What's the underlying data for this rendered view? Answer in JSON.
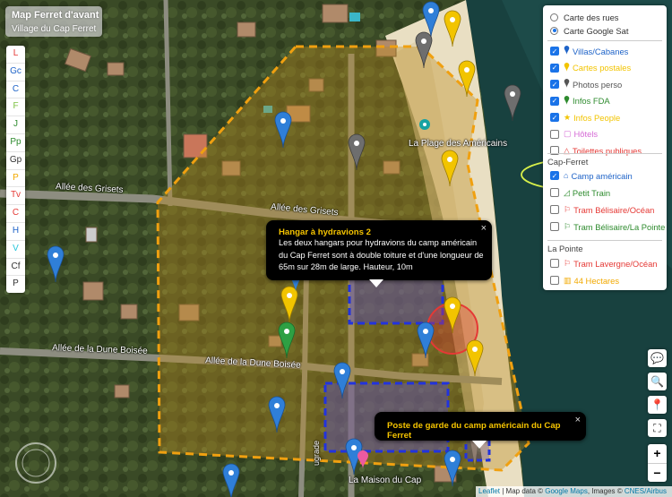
{
  "title": {
    "line1": "Map Ferret d'avant",
    "line2": "Village du Cap Ferret"
  },
  "letters": [
    {
      "t": "L",
      "c": "#e53935"
    },
    {
      "t": "Gc",
      "c": "#1e63c8"
    },
    {
      "t": "C",
      "c": "#1e63c8"
    },
    {
      "t": "F",
      "c": "#7cc242"
    },
    {
      "t": "J",
      "c": "#2e8b2e"
    },
    {
      "t": "Pp",
      "c": "#2e8b2e"
    },
    {
      "t": "Gp",
      "c": "#333333"
    },
    {
      "t": "P",
      "c": "#f2a900"
    },
    {
      "t": "Tv",
      "c": "#e53935"
    },
    {
      "t": "C",
      "c": "#e53935"
    },
    {
      "t": "H",
      "c": "#1e63c8"
    },
    {
      "t": "V",
      "c": "#26c6da"
    },
    {
      "t": "Cf",
      "c": "#333333"
    },
    {
      "t": "P",
      "c": "#333333"
    }
  ],
  "layers": {
    "base": [
      {
        "label": "Carte des rues",
        "checked": false
      },
      {
        "label": "Carte Google Sat",
        "checked": true
      }
    ],
    "overlays": [
      {
        "label": "Villas/Cabanes",
        "checked": true,
        "icon": "pin",
        "color": "#1e63c8"
      },
      {
        "label": "Cartes postales",
        "checked": true,
        "icon": "pin",
        "color": "#f2c400"
      },
      {
        "label": "Photos perso",
        "checked": true,
        "icon": "pin",
        "color": "#555555"
      },
      {
        "label": "Infos FDA",
        "checked": true,
        "icon": "pin",
        "color": "#2e8b2e"
      },
      {
        "label": "Infos People",
        "checked": true,
        "icon": "star",
        "color": "#f2c400"
      },
      {
        "label": "Hôtels",
        "checked": false,
        "icon": "square",
        "color": "#d66bd6"
      },
      {
        "label": "Toilettes publiques",
        "checked": false,
        "icon": "triangle",
        "color": "#e53935"
      }
    ],
    "section1": "Cap-Ferret",
    "cap": [
      {
        "label": "Camp américain",
        "checked": true,
        "icon": "bell",
        "color": "#1e63c8"
      },
      {
        "label": "Petit Train",
        "checked": false,
        "icon": "tri-small",
        "color": "#2e8b2e"
      },
      {
        "label": "Tram Bélisaire/Océan",
        "checked": false,
        "icon": "flag",
        "color": "#e53935"
      },
      {
        "label": "Tram Bélisaire/La Pointe",
        "checked": false,
        "icon": "flag",
        "color": "#2e8b2e"
      }
    ],
    "section2": "La Pointe",
    "pointe": [
      {
        "label": "Tram Lavergne/Océan",
        "checked": false,
        "icon": "flag",
        "color": "#e53935"
      },
      {
        "label": "44 Hectares",
        "checked": false,
        "icon": "bars",
        "color": "#f2a900"
      }
    ]
  },
  "popup1": {
    "title": "Hangar à hydravions 2",
    "lines": [
      "Les deux hangars pour hydravions du camp américain",
      "du Cap Ferret sont à double toiture et d'une longueur de",
      "65m sur 28m de large. Hauteur, 10m"
    ],
    "close": "×"
  },
  "popup2": {
    "title": "Poste de garde du camp américain du Cap Ferret",
    "close": "×"
  },
  "map_labels": {
    "plage": "La Plage des Américains",
    "grisets1": "Allée des Grisets",
    "grisets2": "Allée des Grisets",
    "dune1": "Allée de la Dune Boisée",
    "dune2": "Allée de la Dune Boisée",
    "maison": "La Maison du Cap",
    "grade": "ugrade"
  },
  "controls": {
    "comment": "💬",
    "zoom_search": "🔍",
    "locate": "📍",
    "fullscreen": "⛶",
    "zoom_in": "+",
    "zoom_out": "−"
  },
  "attribution": {
    "leaflet": "Leaflet",
    "sep": " | Map data © ",
    "gmaps": "Google Maps",
    "images": ", Images © ",
    "cnes": "CNES/Airbus"
  },
  "colors": {
    "zone": "#f0a010",
    "hangar": "#2233dd",
    "selection": "#d8f04a",
    "circle": "#e53935"
  }
}
